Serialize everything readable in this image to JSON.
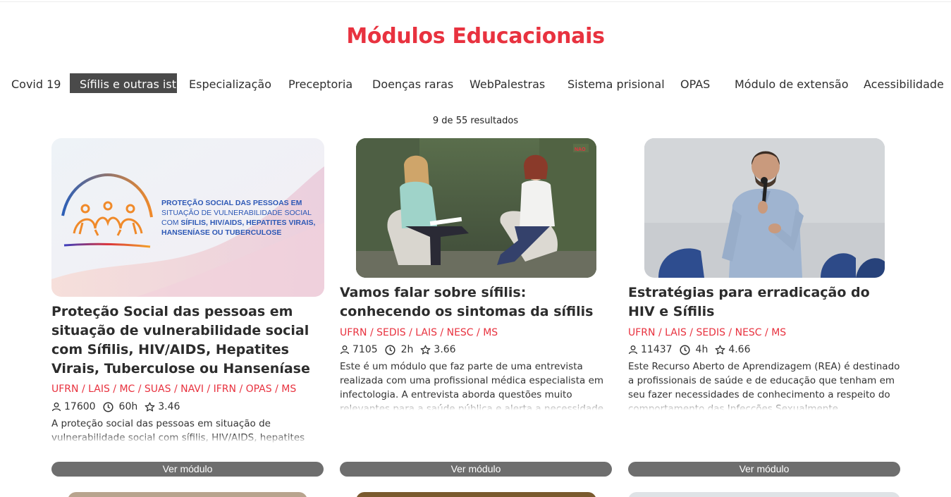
{
  "page_title": "Módulos Educacionais",
  "tabs": [
    {
      "label": "Covid 19",
      "active": false
    },
    {
      "label": "Sífilis e outras ist",
      "active": true
    },
    {
      "label": "Especialização",
      "active": false
    },
    {
      "label": "Preceptoria",
      "active": false
    },
    {
      "label": "Doenças raras",
      "active": false
    },
    {
      "label": "WebPalestras",
      "active": false
    },
    {
      "label": "Sistema prisional",
      "active": false
    },
    {
      "label": "OPAS",
      "active": false
    },
    {
      "label": "Módulo de extensão",
      "active": false
    },
    {
      "label": "Acessibilidade",
      "active": false
    }
  ],
  "results_text": "9 de 55 resultados",
  "cards": [
    {
      "title": "Proteção Social das pessoas em situação de vulnerabilidade social com Sífilis, HIV/AIDS, Hepatites Virais, Tuberculose ou Hanseníase",
      "institutions": "UFRN / LAIS / MC / SUAS / NAVI / IFRN / OPAS / MS",
      "students": "17600",
      "duration": "60h",
      "rating": "3.46",
      "description": "A proteção social das pessoas em situação de vulnerabilidade social com sífilis, HIV/AIDS, hepatites virais, tuberculose ou hanseníase...",
      "button": "Ver módulo",
      "banner_text": {
        "line1": "PROTEÇÃO SOCIAL DAS PESSOAS EM",
        "line2": "SITUAÇÃO DE VULNERABILIDADE SOCIAL",
        "line3a": "COM ",
        "line3b": "SÍFILIS, HIV/AIDS, HEPATITES VIRAIS,",
        "line4": "HANSENÍASE OU TUBERCULOSE"
      }
    },
    {
      "title": "Vamos falar sobre sífilis: conhecendo os sintomas da sífilis",
      "institutions": "UFRN / SEDIS / LAIS / NESC / MS",
      "students": "7105",
      "duration": "2h",
      "rating": "3.66",
      "description": "Este é um módulo que faz parte de uma entrevista realizada com uma profissional médica especialista em infectologia. A entrevista aborda questões muito relevantes para a saúde pública e alerta a necessidade que todos",
      "button": "Ver módulo"
    },
    {
      "title": "Estratégias para erradicação do HIV e Sífilis",
      "institutions": "UFRN / LAIS / SEDIS / NESC / MS",
      "students": "11437",
      "duration": "4h",
      "rating": "4.66",
      "description": "Este Recurso Aberto de Aprendizagem (REA) é destinado a profissionais de saúde e de educação que tenham em seu fazer necessidades de conhecimento a respeito do comportamento das Infecções Sexualmente Transmissíveis",
      "button": "Ver módulo"
    }
  ],
  "colors": {
    "accent": "#e8323f",
    "active_tab": "#4a4a4a",
    "button": "#6e6e6e"
  }
}
